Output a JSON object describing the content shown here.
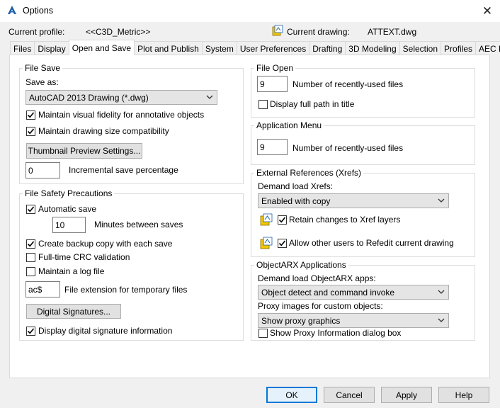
{
  "window": {
    "title": "Options",
    "close_glyph": "✕"
  },
  "profile": {
    "label": "Current profile:",
    "value": "<<C3D_Metric>>"
  },
  "drawing": {
    "label": "Current drawing:",
    "value": "ATTEXT.dwg"
  },
  "tabs": [
    "Files",
    "Display",
    "Open and Save",
    "Plot and Publish",
    "System",
    "User Preferences",
    "Drafting",
    "3D Modeling",
    "Selection",
    "Profiles",
    "AEC Editor"
  ],
  "file_save": {
    "legend": "File Save",
    "save_as_label": "Save as:",
    "save_as_value": "AutoCAD 2013 Drawing (*.dwg)",
    "fidelity_label": "Maintain visual fidelity for annotative objects",
    "size_compat_label": "Maintain drawing size compatibility",
    "thumbnail_button": "Thumbnail Preview Settings...",
    "incremental_value": "0",
    "incremental_label": "Incremental save percentage"
  },
  "file_safety": {
    "legend": "File Safety Precautions",
    "autosave_label": "Automatic save",
    "minutes_value": "10",
    "minutes_label": "Minutes between saves",
    "backup_label": "Create backup copy with each save",
    "crc_label": "Full-time CRC validation",
    "log_label": "Maintain a log file",
    "ext_value": "ac$",
    "ext_label": "File extension for temporary files",
    "digsig_button": "Digital Signatures...",
    "digsig_info_label": "Display digital signature information"
  },
  "file_open": {
    "legend": "File Open",
    "recent_value": "9",
    "recent_label": "Number of recently-used files",
    "fullpath_label": "Display full path in title"
  },
  "app_menu": {
    "legend": "Application Menu",
    "recent_value": "9",
    "recent_label": "Number of recently-used files"
  },
  "xrefs": {
    "legend": "External References (Xrefs)",
    "demand_label": "Demand load Xrefs:",
    "demand_value": "Enabled with copy",
    "retain_label": "Retain changes to Xref layers",
    "refedit_label": "Allow other users to Refedit current drawing"
  },
  "arx": {
    "legend": "ObjectARX Applications",
    "demand_label": "Demand load ObjectARX apps:",
    "demand_value": "Object detect and command invoke",
    "proxy_label": "Proxy images for custom objects:",
    "proxy_value": "Show proxy graphics",
    "proxy_info_label": "Show Proxy Information dialog box"
  },
  "buttons": {
    "ok": "OK",
    "cancel": "Cancel",
    "apply": "Apply",
    "help": "Help"
  },
  "colors": {
    "accent": "#0078d7",
    "check": "#000000",
    "icon_yellow": "#f2c500",
    "icon_blue": "#1f5fa8"
  }
}
